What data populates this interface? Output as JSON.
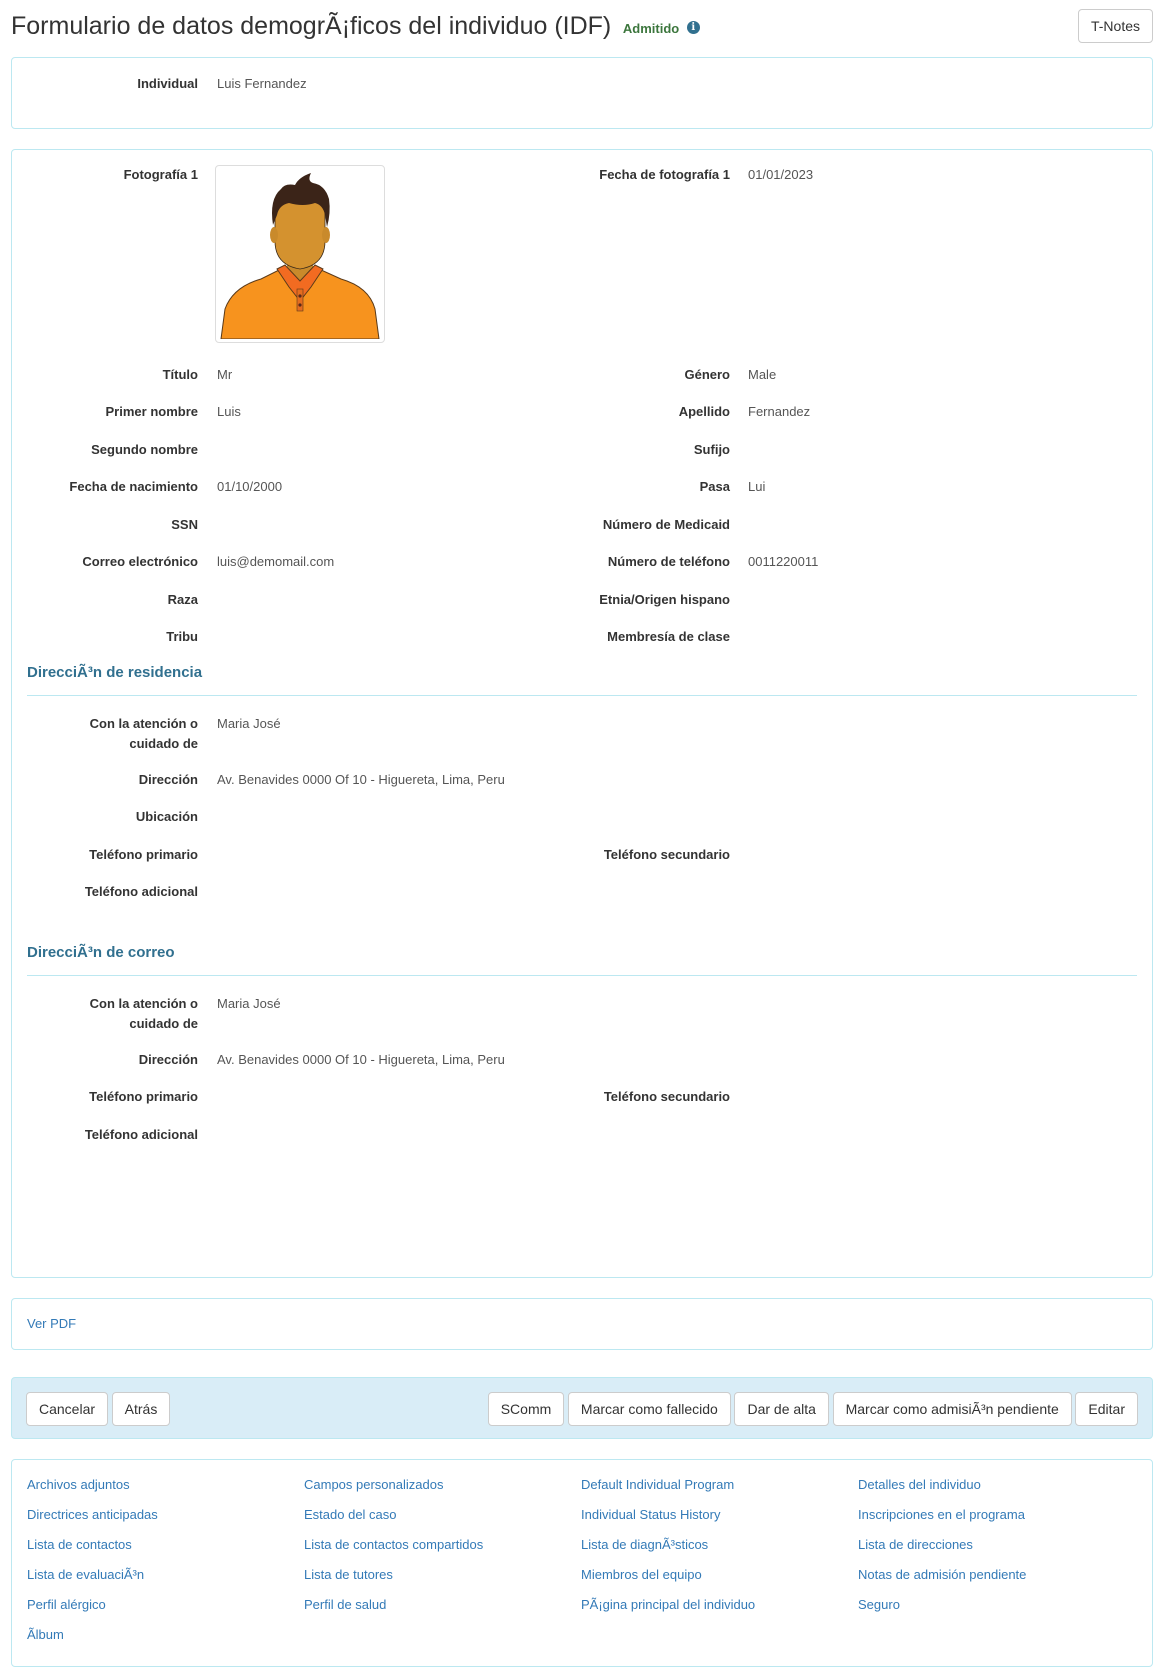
{
  "header": {
    "title": "Formulario de datos demogrÃ¡ficos del individuo (IDF)",
    "status": "Admitido",
    "info_icon": "info-circle-icon",
    "tnotes_label": "T-Notes"
  },
  "individual_panel": {
    "label": "Individual",
    "value": "Luis Fernandez"
  },
  "details": {
    "photo_label": "Fotografía 1",
    "photo_icon": "person-avatar-image",
    "photo_date_label": "Fecha de fotografía 1",
    "photo_date_value": "01/01/2023",
    "left_fields": [
      {
        "label": "Título",
        "value": "Mr"
      },
      {
        "label": "Primer nombre",
        "value": "Luis"
      },
      {
        "label": "Segundo nombre",
        "value": ""
      },
      {
        "label": "Fecha de nacimiento",
        "value": "01/10/2000"
      },
      {
        "label": "SSN",
        "value": ""
      },
      {
        "label": "Correo electrónico",
        "value": "luis@demomail.com"
      },
      {
        "label": "Raza",
        "value": ""
      },
      {
        "label": "Tribu",
        "value": ""
      }
    ],
    "right_fields": [
      {
        "label": "Género",
        "value": "Male"
      },
      {
        "label": "Apellido",
        "value": "Fernandez"
      },
      {
        "label": "Sufijo",
        "value": ""
      },
      {
        "label": "Pasa",
        "value": "Lui"
      },
      {
        "label": "Número de Medicaid",
        "value": ""
      },
      {
        "label": "Número de teléfono",
        "value": "0011220011"
      },
      {
        "label": "Etnia/Origen hispano",
        "value": ""
      },
      {
        "label": "Membresía de clase",
        "value": ""
      }
    ]
  },
  "residence": {
    "title": "DirecciÃ³n de residencia",
    "care_of_label_1": "Con la atención o",
    "care_of_label_2": "cuidado de",
    "care_of_value": "Maria José",
    "address_label": "Dirección",
    "address_value": "Av. Benavides 0000 Of 10 - Higuereta, Lima, Peru",
    "location_label": "Ubicación",
    "location_value": "",
    "primary_phone_label": "Teléfono primario",
    "primary_phone_value": "",
    "secondary_phone_label": "Teléfono secundario",
    "secondary_phone_value": "",
    "additional_phone_label": "Teléfono adicional",
    "additional_phone_value": ""
  },
  "mailing": {
    "title": "DirecciÃ³n de correo",
    "care_of_label_1": "Con la atención o",
    "care_of_label_2": "cuidado de",
    "care_of_value": "Maria José",
    "address_label": "Dirección",
    "address_value": "Av. Benavides 0000 Of 10 - Higuereta, Lima, Peru",
    "primary_phone_label": "Teléfono primario",
    "primary_phone_value": "",
    "secondary_phone_label": "Teléfono secundario",
    "secondary_phone_value": "",
    "additional_phone_label": "Teléfono adicional",
    "additional_phone_value": ""
  },
  "pdf": {
    "label": "Ver PDF"
  },
  "actions": {
    "left": [
      "Cancelar",
      "Atrás"
    ],
    "right": [
      "SComm",
      "Marcar como fallecido",
      "Dar de alta",
      "Marcar como admisiÃ³n pendiente",
      "Editar"
    ]
  },
  "links": {
    "columns": [
      [
        "Archivos adjuntos",
        "Directrices anticipadas",
        "Lista de contactos",
        "Lista de evaluaciÃ³n",
        "Perfil alérgico",
        "Ãlbum"
      ],
      [
        "Campos personalizados",
        "Estado del caso",
        "Lista de contactos compartidos",
        "Lista de tutores",
        "Perfil de salud"
      ],
      [
        "Default Individual Program",
        "Individual Status History",
        "Lista de diagnÃ³sticos",
        "Miembros del equipo",
        "PÃ¡gina principal del individuo"
      ],
      [
        "Detalles del individuo",
        "Inscripciones en el programa",
        "Lista de direcciones",
        "Notas de admisión pendiente",
        "Seguro"
      ]
    ]
  },
  "colors": {
    "status_green": "#3c763d",
    "heading_blue": "#31708f",
    "link_blue": "#337ab7",
    "panel_border": "#bce8f1",
    "action_bg": "#d9edf7"
  }
}
